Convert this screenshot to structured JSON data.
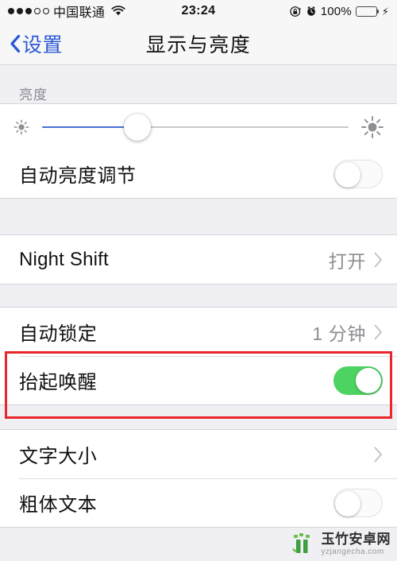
{
  "status_bar": {
    "signal_dots_filled": 3,
    "signal_dots_total": 5,
    "carrier": "中国联通",
    "wifi_icon": "wifi-icon",
    "time": "23:24",
    "rotation_lock_icon": "rotation-lock-icon",
    "alarm_icon": "alarm-clock-icon",
    "battery_percent": "100%",
    "battery_level": 100,
    "battery_color": "#4cd964",
    "charging_icon": "lightning-bolt-icon"
  },
  "nav_bar": {
    "back_icon": "chevron-left-icon",
    "back_label": "设置",
    "title": "显示与亮度",
    "accent_color": "#2b59d4"
  },
  "brightness_section": {
    "header": "亮度",
    "slider": {
      "low_icon": "sun-small-icon",
      "high_icon": "sun-large-icon",
      "value_percent": 31,
      "fill_color": "#4a6fd4",
      "track_color": "#c9c9ce"
    },
    "auto_brightness": {
      "label": "自动亮度调节",
      "toggle_state": "off"
    }
  },
  "night_shift_section": {
    "rows": [
      {
        "label": "Night Shift",
        "value": "打开",
        "accessory": "chevron-right-icon",
        "latin": true
      }
    ]
  },
  "lock_section": {
    "rows": [
      {
        "label": "自动锁定",
        "value": "1 分钟",
        "accessory": "chevron-right-icon"
      },
      {
        "label": "抬起唤醒",
        "toggle_state": "on"
      }
    ],
    "toggle_on_color": "#4cd362"
  },
  "text_section": {
    "rows": [
      {
        "label": "文字大小",
        "accessory": "chevron-right-icon"
      },
      {
        "label": "粗体文本",
        "toggle_state": "off"
      }
    ]
  },
  "annotation": {
    "color": "#e8262b",
    "target": "抬起唤醒"
  },
  "watermark": {
    "logo_icon": "bamboo-logo-icon",
    "name": "玉竹安卓网",
    "url": "yzjangecha.com"
  }
}
